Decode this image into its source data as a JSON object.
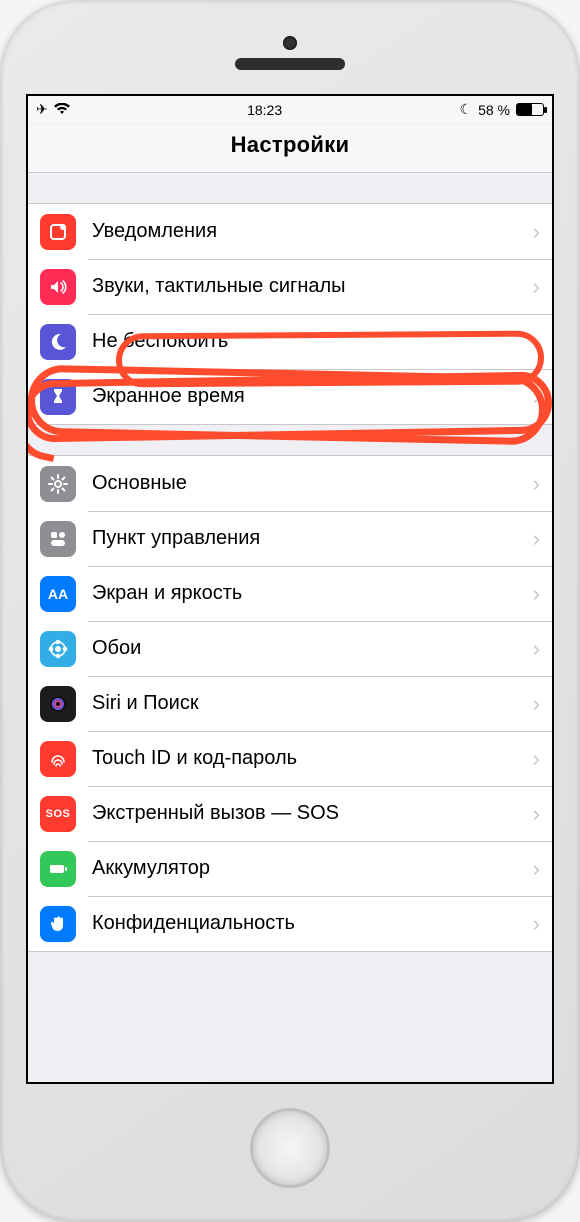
{
  "statusbar": {
    "time": "18:23",
    "battery_pct": "58 %",
    "battery_fill_pct": 58
  },
  "nav": {
    "title": "Настройки"
  },
  "group1": [
    {
      "label": "Уведомления",
      "icon": "notifications-icon",
      "icon_bg": "ic-red",
      "glyph": "▢"
    },
    {
      "label": "Звуки, тактильные сигналы",
      "icon": "sounds-icon",
      "icon_bg": "ic-pink",
      "glyph": "🔈"
    },
    {
      "label": "Не беспокоить",
      "icon": "do-not-disturb-icon",
      "icon_bg": "ic-indigo",
      "glyph": "☾"
    },
    {
      "label": "Экранное время",
      "icon": "screen-time-icon",
      "icon_bg": "ic-indigo",
      "glyph": "⧗"
    }
  ],
  "group2": [
    {
      "label": "Основные",
      "icon": "general-icon",
      "icon_bg": "ic-gray",
      "glyph": "⚙"
    },
    {
      "label": "Пункт управления",
      "icon": "control-center-icon",
      "icon_bg": "ic-gray2",
      "glyph": "◉"
    },
    {
      "label": "Экран и яркость",
      "icon": "display-icon",
      "icon_bg": "ic-blue",
      "glyph": "AA"
    },
    {
      "label": "Обои",
      "icon": "wallpaper-icon",
      "icon_bg": "ic-cyan",
      "glyph": "❀"
    },
    {
      "label": "Siri и Поиск",
      "icon": "siri-icon",
      "icon_bg": "ic-black",
      "glyph": "◉"
    },
    {
      "label": "Touch ID и код-пароль",
      "icon": "touchid-icon",
      "icon_bg": "ic-red2",
      "glyph": "◉"
    },
    {
      "label": "Экстренный вызов — SOS",
      "icon": "sos-icon",
      "icon_bg": "ic-sos",
      "glyph": "SOS"
    },
    {
      "label": "Аккумулятор",
      "icon": "battery-icon",
      "icon_bg": "ic-green",
      "glyph": "▭"
    },
    {
      "label": "Конфиденциальность",
      "icon": "privacy-icon",
      "icon_bg": "ic-hand",
      "glyph": "✋"
    }
  ],
  "annotation": {
    "highlighted_row_index": 3
  }
}
